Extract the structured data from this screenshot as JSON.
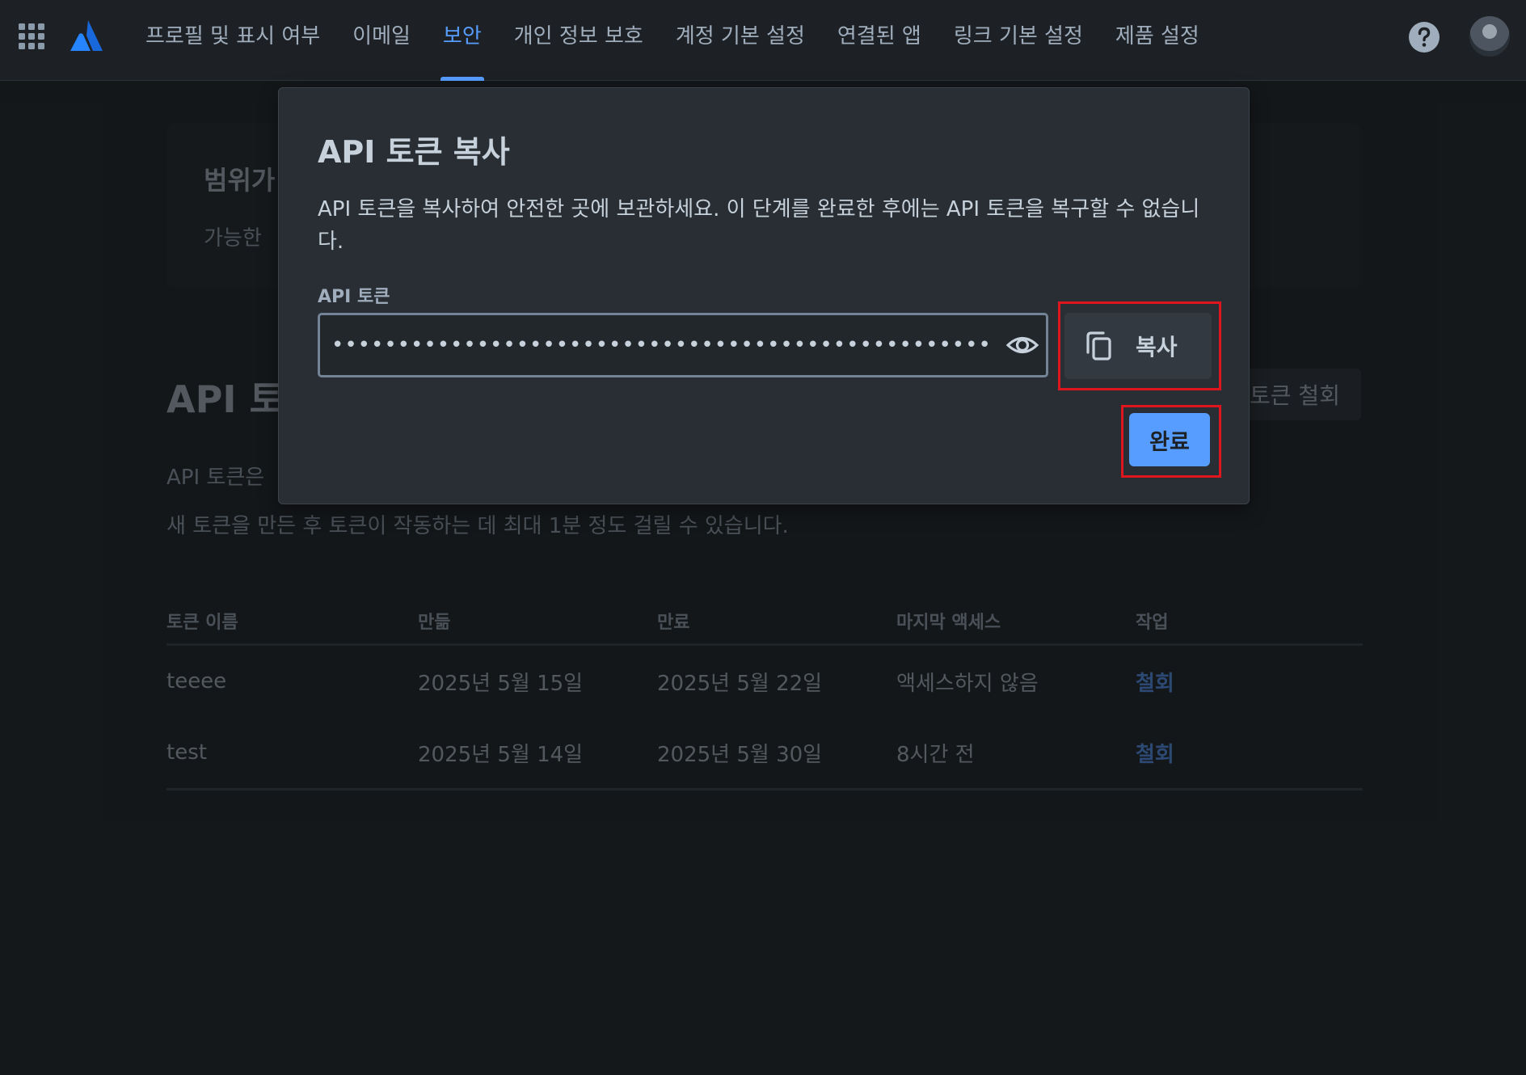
{
  "nav": {
    "tabs": [
      {
        "label": "프로필 및 표시 여부"
      },
      {
        "label": "이메일"
      },
      {
        "label": "보안"
      },
      {
        "label": "개인 정보 보호"
      },
      {
        "label": "계정 기본 설정"
      },
      {
        "label": "연결된 앱"
      },
      {
        "label": "링크 기본 설정"
      },
      {
        "label": "제품 설정"
      }
    ],
    "active_tab": "보안"
  },
  "background": {
    "info_card": {
      "title": "범위가",
      "body": "가능한"
    },
    "section_title": "API 토큰",
    "revoke_all_label": "토큰 철회",
    "description_line1": "API 토큰은",
    "description_line2": "새 토큰을 만든 후 토큰이 작동하는 데 최대 1분 정도 걸릴 수 있습니다.",
    "table": {
      "headers": [
        "토큰 이름",
        "만듦",
        "만료",
        "마지막 액세스",
        "작업"
      ],
      "rows": [
        {
          "name": "teeee",
          "created": "2025년 5월 15일",
          "expires": "2025년 5월 22일",
          "last_access": "액세스하지 않음",
          "action": "철회"
        },
        {
          "name": "test",
          "created": "2025년 5월 14일",
          "expires": "2025년 5월 30일",
          "last_access": "8시간 전",
          "action": "철회"
        }
      ]
    }
  },
  "modal": {
    "title": "API 토큰 복사",
    "description": "API 토큰을 복사하여 안전한 곳에 보관하세요. 이 단계를 완료한 후에는 API 토큰을 복구할 수 없습니다.",
    "field_label": "API 토큰",
    "token_value_masked": "••••••••••••••••••••••••••••••••••••••••••••••••••••••••••••••••••••••••••",
    "copy_label": "복사",
    "done_label": "완료"
  },
  "colors": {
    "background": "#1d2125",
    "accent": "#579dff",
    "highlight_box": "#e0161f",
    "modal_bg": "#282e33"
  },
  "icons": [
    "apps-grid-icon",
    "atlassian-logo-icon",
    "help-icon",
    "eye-icon",
    "copy-icon"
  ]
}
